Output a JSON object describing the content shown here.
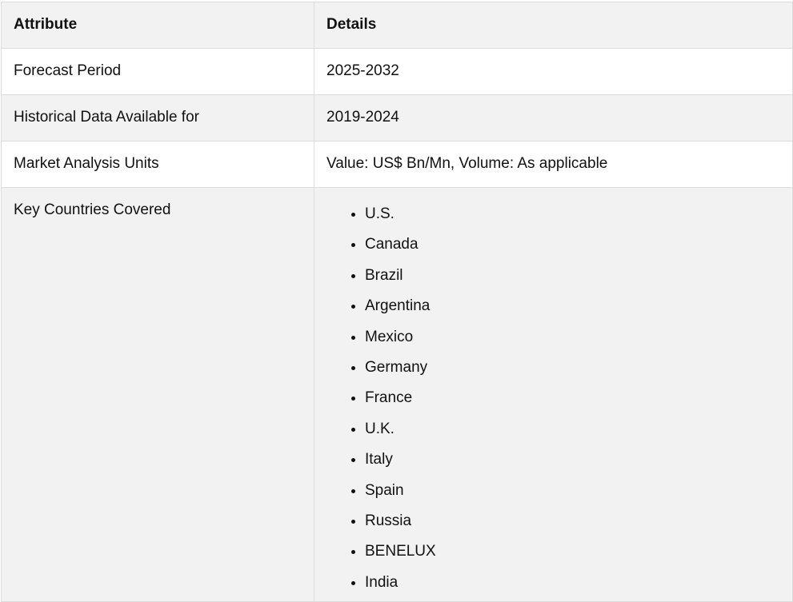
{
  "table": {
    "headers": {
      "attribute": "Attribute",
      "details": "Details"
    },
    "rows": [
      {
        "attribute": "Forecast Period",
        "details": "2025-2032"
      },
      {
        "attribute": "Historical Data Available for",
        "details": "2019-2024"
      },
      {
        "attribute": "Market Analysis Units",
        "details": "Value: US$ Bn/Mn, Volume: As applicable"
      }
    ],
    "countries_row": {
      "attribute": "Key Countries Covered",
      "countries": [
        "U.S.",
        "Canada",
        "Brazil",
        "Argentina",
        "Mexico",
        "Germany",
        "France",
        "U.K.",
        "Italy",
        "Spain",
        "Russia",
        "BENELUX",
        "India"
      ]
    }
  }
}
